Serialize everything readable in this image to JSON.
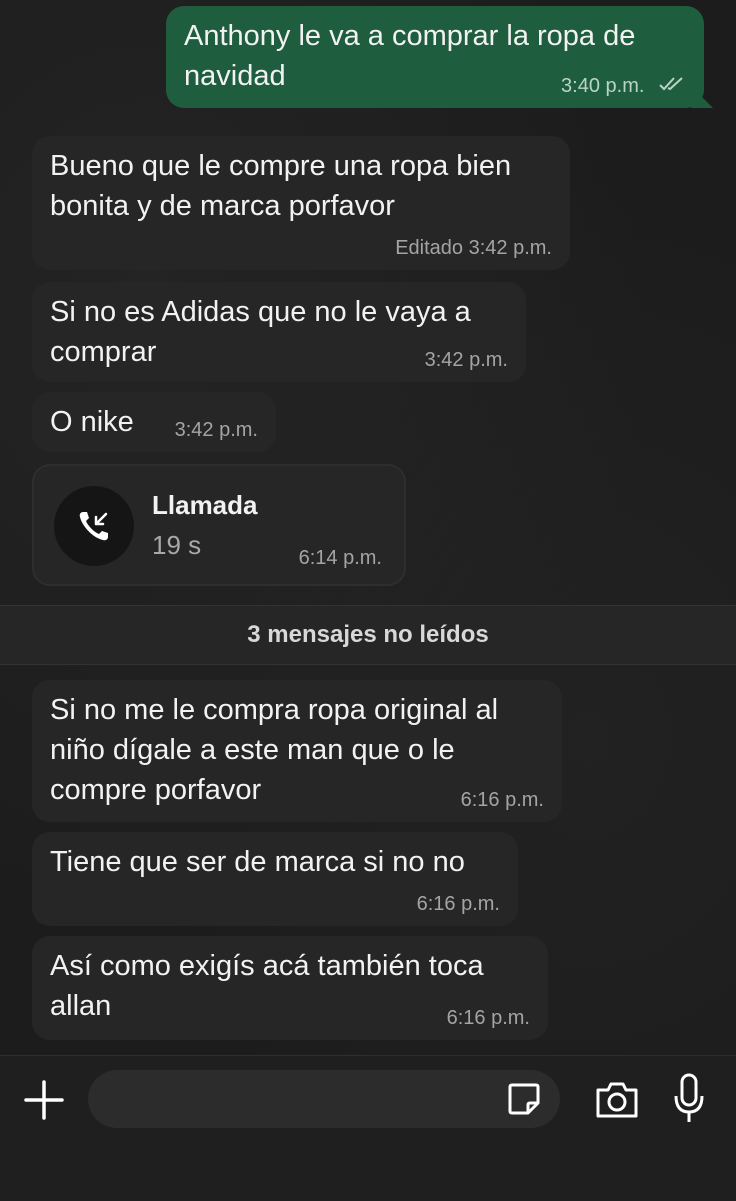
{
  "messages": [
    {
      "text": "Anthony le va a comprar la ropa de navidad",
      "time": "3:40 p.m."
    },
    {
      "text": "Bueno que le compre una ropa bien bonita y de marca porfavor",
      "time": "Editado 3:42 p.m."
    },
    {
      "text": "Si no es Adidas que no le vaya a comprar",
      "time": "3:42 p.m."
    },
    {
      "text": "O nike",
      "time": "3:42 p.m."
    },
    {
      "text": "Si no me le compra ropa original al niño dígale a este man que o le compre porfavor",
      "time": "6:16 p.m."
    },
    {
      "text": "Tiene que ser de marca si no no",
      "time": "6:16 p.m."
    },
    {
      "text": "Así como exigís acá también toca allan",
      "time": "6:16 p.m."
    }
  ],
  "call": {
    "title": "Llamada",
    "duration": "19 s",
    "time": "6:14 p.m.",
    "icon": "incoming-call-icon"
  },
  "unread_divider": "3 mensajes no leídos",
  "colors": {
    "outgoing_bubble": "#1e5d3e",
    "incoming_bubble": "#262626",
    "background": "#1c1c1c"
  },
  "input_bar": {
    "icons": [
      "plus-icon",
      "sticker-icon",
      "camera-icon",
      "microphone-icon"
    ]
  }
}
